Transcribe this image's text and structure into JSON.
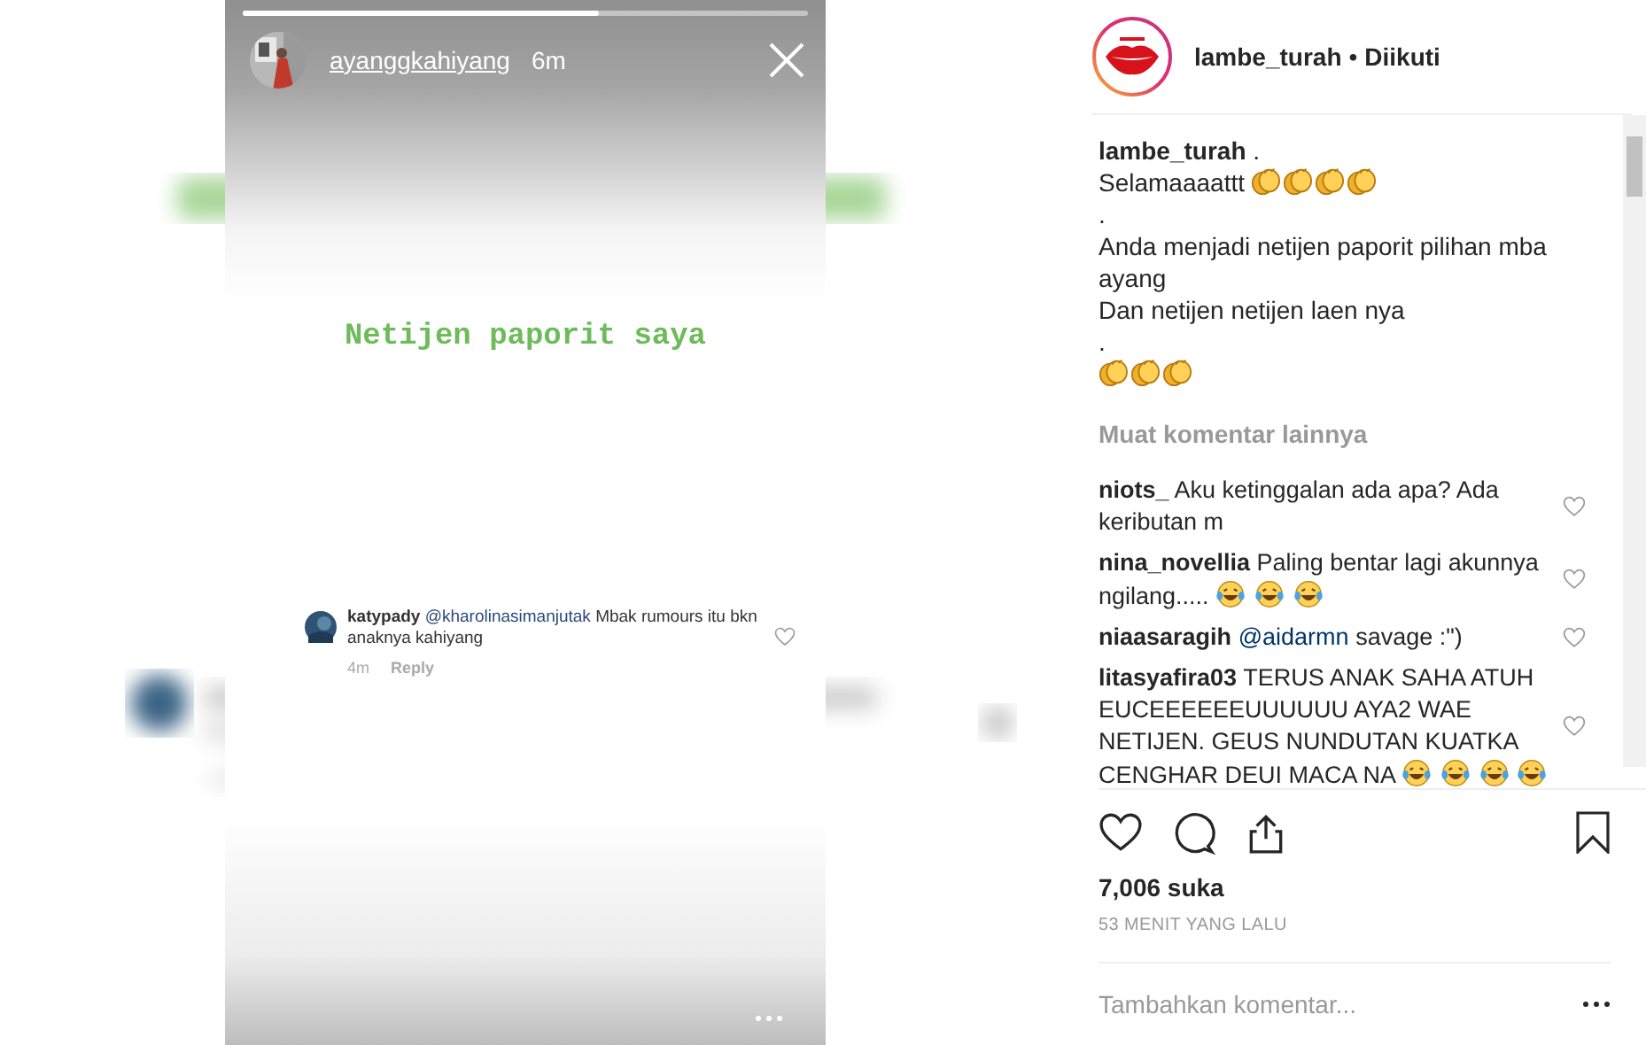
{
  "story": {
    "progress": {
      "level": 0.63
    },
    "username": "ayanggkahiyang",
    "time": "6m",
    "text": "Netijen paporit saya",
    "comment": {
      "username": "katypady",
      "mention": "@kharolinasimanjutak",
      "text": "Mbak rumours itu bkn anaknya kahiyang",
      "time": "4m",
      "reply": "Reply",
      "liked": false
    }
  },
  "post": {
    "username": "lambe_turah",
    "separator": "•",
    "follow": "Diikuti",
    "caption": {
      "username": "lambe_turah",
      "lines": [
        {
          "text": "."
        },
        {
          "text": "Selamaaaattt",
          "emoji": [
            {
              "kind": "clap"
            },
            {
              "kind": "clap"
            },
            {
              "kind": "clap"
            },
            {
              "kind": "clap"
            }
          ]
        },
        {
          "text": "."
        },
        {
          "text": "Anda menjadi netijen paporit pilihan mba ayang"
        },
        {
          "text": "Dan netijen netijen laen nya"
        },
        {
          "text": "."
        },
        {
          "emoji": [
            {
              "kind": "clap"
            },
            {
              "kind": "clap"
            },
            {
              "kind": "clap"
            }
          ]
        }
      ]
    },
    "load_more": "Muat komentar lainnya",
    "comments": [
      {
        "username": "niots_",
        "text": "Aku ketinggalan ada apa? Ada keributan m",
        "liked": false
      },
      {
        "username": "nina_novellia",
        "text": "Paling bentar lagi akunnya ngilang.....",
        "emoji": [
          {
            "kind": "laugh"
          },
          {
            "kind": "laugh"
          },
          {
            "kind": "laugh"
          }
        ],
        "liked": false
      },
      {
        "username": "niaasaragih",
        "mention": "@aidarmn",
        "text": "savage :\")",
        "liked": false
      },
      {
        "username": "litasyafira03",
        "text": "TERUS ANAK SAHA ATUH EUCEEEEEEUUUUUU AYA2 WAE NETIJEN. GEUS NUNDUTAN KUATKA CENGHAR DEUI MACA NA",
        "emoji": [
          {
            "kind": "laugh"
          },
          {
            "kind": "laugh"
          },
          {
            "kind": "laugh"
          },
          {
            "kind": "laugh"
          }
        ],
        "liked": false
      }
    ],
    "liked": false,
    "saved": false,
    "likes": "7,006 suka",
    "time": "53 MENIT YANG LALU",
    "comment_field": {
      "placeholder": "Tambahkan komentar..."
    }
  }
}
